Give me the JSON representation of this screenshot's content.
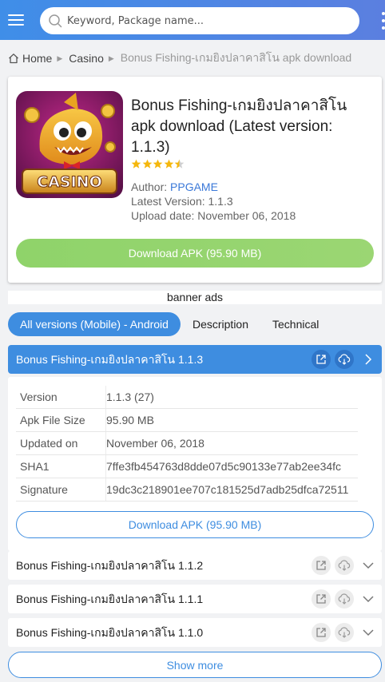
{
  "header": {
    "search_placeholder": "Keyword, Package name..."
  },
  "breadcrumb": {
    "home": "Home",
    "category": "Casino",
    "current": "Bonus Fishing-เกมยิงปลาคาสิโน apk download"
  },
  "app": {
    "title": "Bonus Fishing-เกมยิงปลาคาสิโน apk download (Latest version: 1.1.3)",
    "icon_text": "CASINO",
    "rating": 4.5,
    "author_label": "Author: ",
    "author": "PPGAME",
    "latest_version": "Latest Version: 1.1.3",
    "upload_date": "Upload date: November 06, 2018",
    "download_label": "Download APK (95.90 MB)"
  },
  "banner": "banner ads",
  "tabs": [
    "All versions (Mobile) - Android",
    "Description",
    "Technical"
  ],
  "current_version": {
    "title": "Bonus Fishing-เกมยิงปลาคาสิโน 1.1.3",
    "details": [
      {
        "key": "Version",
        "value": "1.1.3 (27)"
      },
      {
        "key": "Apk File Size",
        "value": "95.90 MB"
      },
      {
        "key": "Updated on",
        "value": "November 06, 2018"
      },
      {
        "key": "SHA1",
        "value": "7ffe3fb454763d8dde07d5c90133e77ab2ee34fc"
      },
      {
        "key": "Signature",
        "value": "19dc3c218901ee707c181525d7adb25dfca72511"
      }
    ],
    "download_label": "Download APK (95.90 MB)"
  },
  "older_versions": [
    {
      "title": "Bonus Fishing-เกมยิงปลาคาสิโน 1.1.2"
    },
    {
      "title": "Bonus Fishing-เกมยิงปลาคาสิโน 1.1.1"
    },
    {
      "title": "Bonus Fishing-เกมยิงปลาคาสิโน 1.1.0"
    }
  ],
  "show_more": "Show more",
  "colors": {
    "accent": "#3e8de0",
    "download_green": "#8fd36a",
    "author_link": "#3a78d8",
    "star": "#f5b70d"
  },
  "icons": {
    "menu": "hamburger-menu-icon",
    "search": "search-icon",
    "more": "more-vertical-icon",
    "home": "home-icon",
    "open": "external-link-icon",
    "cloud": "cloud-download-icon",
    "chevron_right": "chevron-right-icon",
    "chevron_down": "chevron-down-icon",
    "star": "star-icon"
  }
}
